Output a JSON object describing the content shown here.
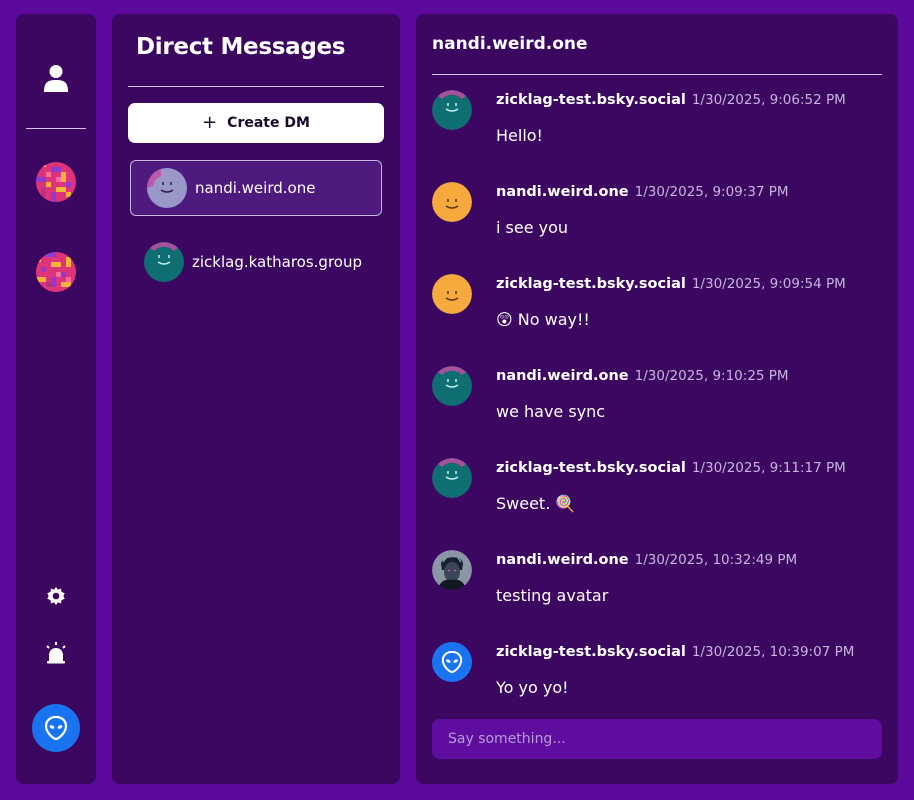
{
  "colors": {
    "background": "#5b0a9b",
    "panel": "#3b0760",
    "accent_blue": "#1a74f2",
    "avatar_teal": "#0f6e72",
    "avatar_orange": "#f6a93c",
    "avatar_lavender": "#9a98c8",
    "input_bg": "#5f0d9e"
  },
  "rail": {
    "icons": [
      "user-icon",
      "space-avatar",
      "space-avatar",
      "settings-icon",
      "alert-icon",
      "alien-icon"
    ]
  },
  "dm_panel": {
    "title": "Direct Messages",
    "create_label": "Create DM",
    "items": [
      {
        "name": "nandi.weird.one",
        "avatar": "lavender",
        "active": true
      },
      {
        "name": "zicklag.katharos.group",
        "avatar": "teal",
        "active": false
      }
    ]
  },
  "chat": {
    "title": "nandi.weird.one",
    "messages": [
      {
        "author": "zicklag-test.bsky.social",
        "time": "1/30/2025, 9:06:52 PM",
        "text": "Hello!",
        "avatar": "teal"
      },
      {
        "author": "nandi.weird.one",
        "time": "1/30/2025, 9:09:37 PM",
        "text": "i see you",
        "avatar": "orange"
      },
      {
        "author": "zicklag-test.bsky.social",
        "time": "1/30/2025, 9:09:54 PM",
        "text": "😲 No way!!",
        "avatar": "orange"
      },
      {
        "author": "nandi.weird.one",
        "time": "1/30/2025, 9:10:25 PM",
        "text": "we have sync",
        "avatar": "teal"
      },
      {
        "author": "zicklag-test.bsky.social",
        "time": "1/30/2025, 9:11:17 PM",
        "text": "Sweet. 🍭",
        "avatar": "teal"
      },
      {
        "author": "nandi.weird.one",
        "time": "1/30/2025, 10:32:49 PM",
        "text": "testing avatar",
        "avatar": "photo"
      },
      {
        "author": "zicklag-test.bsky.social",
        "time": "1/30/2025, 10:39:07 PM",
        "text": "Yo yo yo!",
        "avatar": "alien"
      }
    ],
    "input_placeholder": "Say something..."
  }
}
